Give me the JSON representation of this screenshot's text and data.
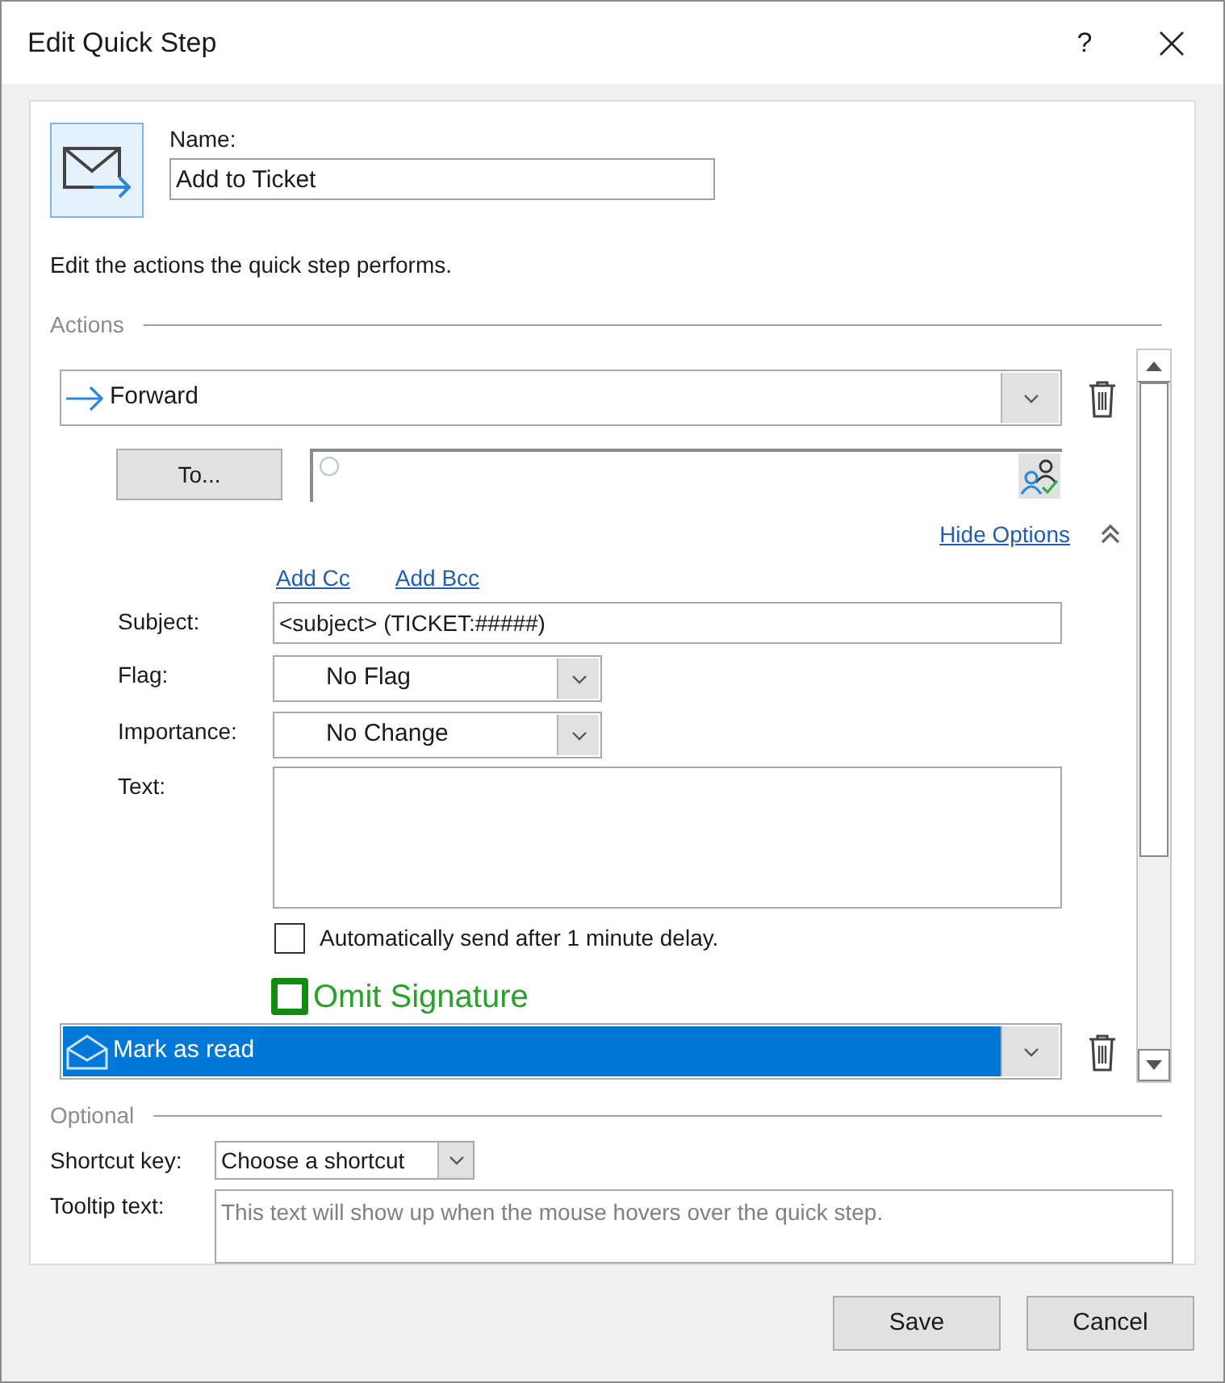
{
  "window": {
    "title": "Edit Quick Step",
    "help": "?"
  },
  "name": {
    "label": "Name:",
    "value": "Add to Ticket"
  },
  "description": "Edit the actions the quick step performs.",
  "actions": {
    "heading": "Actions",
    "items": [
      {
        "kind": "forward",
        "action": "Forward",
        "selected": false,
        "to_button": "To...",
        "hide_options": "Hide Options",
        "add_cc": "Add Cc",
        "add_bcc": "Add Bcc",
        "subject": {
          "label": "Subject:",
          "value": "<subject> (TICKET:#####)"
        },
        "flag": {
          "label": "Flag:",
          "value": "No Flag"
        },
        "importance": {
          "label": "Importance:",
          "value": "No Change"
        },
        "text": {
          "label": "Text:"
        },
        "auto_send": {
          "label": "Automatically send after 1 minute delay.",
          "checked": false
        },
        "omit_signature": {
          "label": "Omit Signature",
          "checked": false
        }
      },
      {
        "kind": "mark_read",
        "action": "Mark as read",
        "selected": true
      }
    ]
  },
  "optional": {
    "heading": "Optional",
    "shortcut": {
      "label": "Shortcut key:",
      "value": "Choose a shortcut"
    },
    "tooltip": {
      "label": "Tooltip text:",
      "placeholder": "This text will show up when the mouse hovers over the quick step."
    }
  },
  "buttons": [
    "Save",
    "Cancel"
  ]
}
